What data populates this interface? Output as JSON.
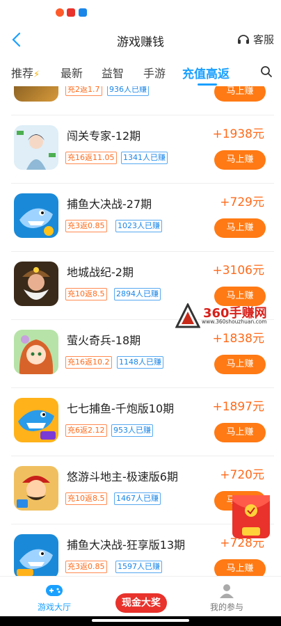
{
  "header": {
    "title": "游戏赚钱",
    "service_label": "客服"
  },
  "tabs": [
    {
      "label": "推荐"
    },
    {
      "label": "最新"
    },
    {
      "label": "益智"
    },
    {
      "label": "手游"
    },
    {
      "label": "充值高返"
    }
  ],
  "list": [
    {
      "name": "",
      "badge1": "充2返1.7",
      "badge2": "936人已赚",
      "reward": "",
      "button": "马上赚"
    },
    {
      "name": "闯关专家-12期",
      "badge1": "充16返11.05",
      "badge2": "1341人已赚",
      "reward": "+1938元",
      "button": "马上赚"
    },
    {
      "name": "捕鱼大决战-27期",
      "badge1": "充3返0.85",
      "badge2": "1023人已赚",
      "reward": "+729元",
      "button": "马上赚"
    },
    {
      "name": "地城战纪-2期",
      "badge1": "充10返8.5",
      "badge2": "2894人已赚",
      "reward": "+3106元",
      "button": "马上赚"
    },
    {
      "name": "萤火奇兵-18期",
      "badge1": "充16返10.2",
      "badge2": "1148人已赚",
      "reward": "+1838元",
      "button": "马上赚"
    },
    {
      "name": "七七捕鱼-千炮版10期",
      "badge1": "充6返2.12",
      "badge2": "953人已赚",
      "reward": "+1897元",
      "button": "马上赚"
    },
    {
      "name": "悠游斗地主-极速版6期",
      "badge1": "充10返8.5",
      "badge2": "1467人已赚",
      "reward": "+720元",
      "button": "马上赚"
    },
    {
      "name": "捕鱼大决战-狂享版13期",
      "badge1": "充3返0.85",
      "badge2": "1597人已赚",
      "reward": "+728元",
      "button": "马上赚"
    }
  ],
  "watermark": {
    "brand": "360手赚网",
    "url": "www.360shouzhuan.com"
  },
  "bottom_nav": [
    {
      "label": "游戏大厅"
    },
    {
      "label": "现金大奖"
    },
    {
      "label": "我的参与"
    }
  ],
  "colors": {
    "accent": "#1aa0ff",
    "orange": "#ff7a14",
    "red": "#e8322b"
  }
}
